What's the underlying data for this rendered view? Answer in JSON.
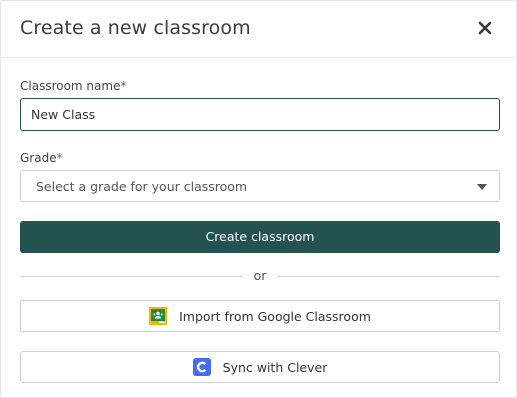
{
  "modal": {
    "title": "Create a new classroom",
    "close_icon": "close-icon"
  },
  "form": {
    "classroom_name": {
      "label": "Classroom name",
      "required_mark": "*",
      "value": "New Class"
    },
    "grade": {
      "label": "Grade",
      "required_mark": "*",
      "selected_text": "Select a grade for your classroom",
      "caret_icon": "caret-down-icon"
    },
    "create_button_label": "Create classroom",
    "divider_text": "or",
    "import_google": {
      "label": "Import from Google Classroom",
      "icon": "google-classroom-icon"
    },
    "sync_clever": {
      "label": "Sync with Clever",
      "icon": "clever-icon"
    }
  },
  "colors": {
    "primary": "#235251",
    "required": "#c0392b",
    "clever_blue": "#436cf2",
    "google_green": "#1e8e3e",
    "google_yellow": "#f4b400"
  }
}
